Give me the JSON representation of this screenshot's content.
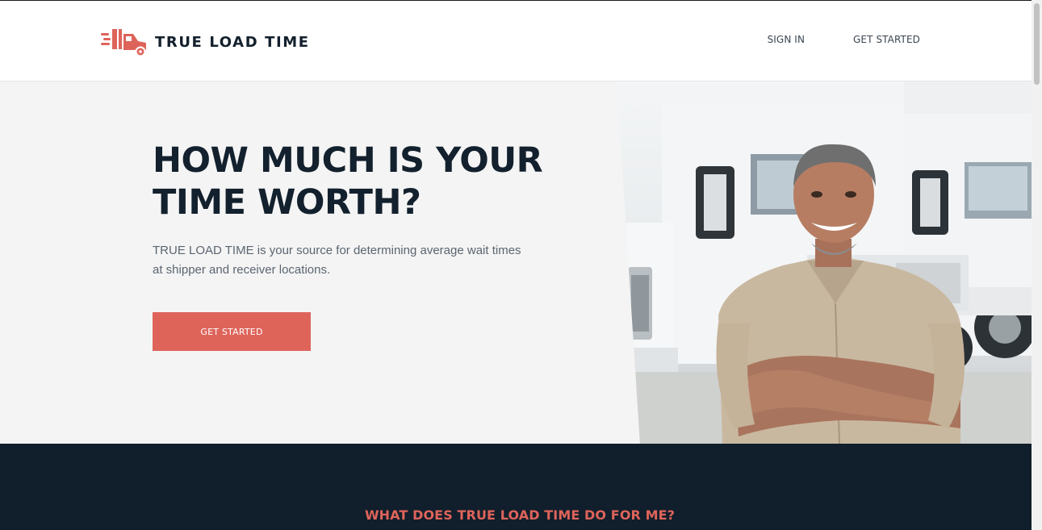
{
  "header": {
    "brand": "TRUE LOAD TIME",
    "logo_icon": "truck-icon",
    "nav": {
      "sign_in": "SIGN IN",
      "get_started": "GET STARTED"
    }
  },
  "hero": {
    "title": "HOW MUCH IS YOUR TIME WORTH?",
    "description": "TRUE LOAD TIME is your source for determining average wait times at shipper and receiver locations.",
    "cta_label": "GET STARTED",
    "image_alt": "Smiling truck driver with arms crossed in front of white semi trucks"
  },
  "section": {
    "heading": "WHAT DOES TRUE LOAD TIME DO FOR ME?"
  },
  "colors": {
    "accent": "#de645a",
    "dark": "#111e2b",
    "hero_bg": "#f4f4f4",
    "text": "#13202d"
  }
}
